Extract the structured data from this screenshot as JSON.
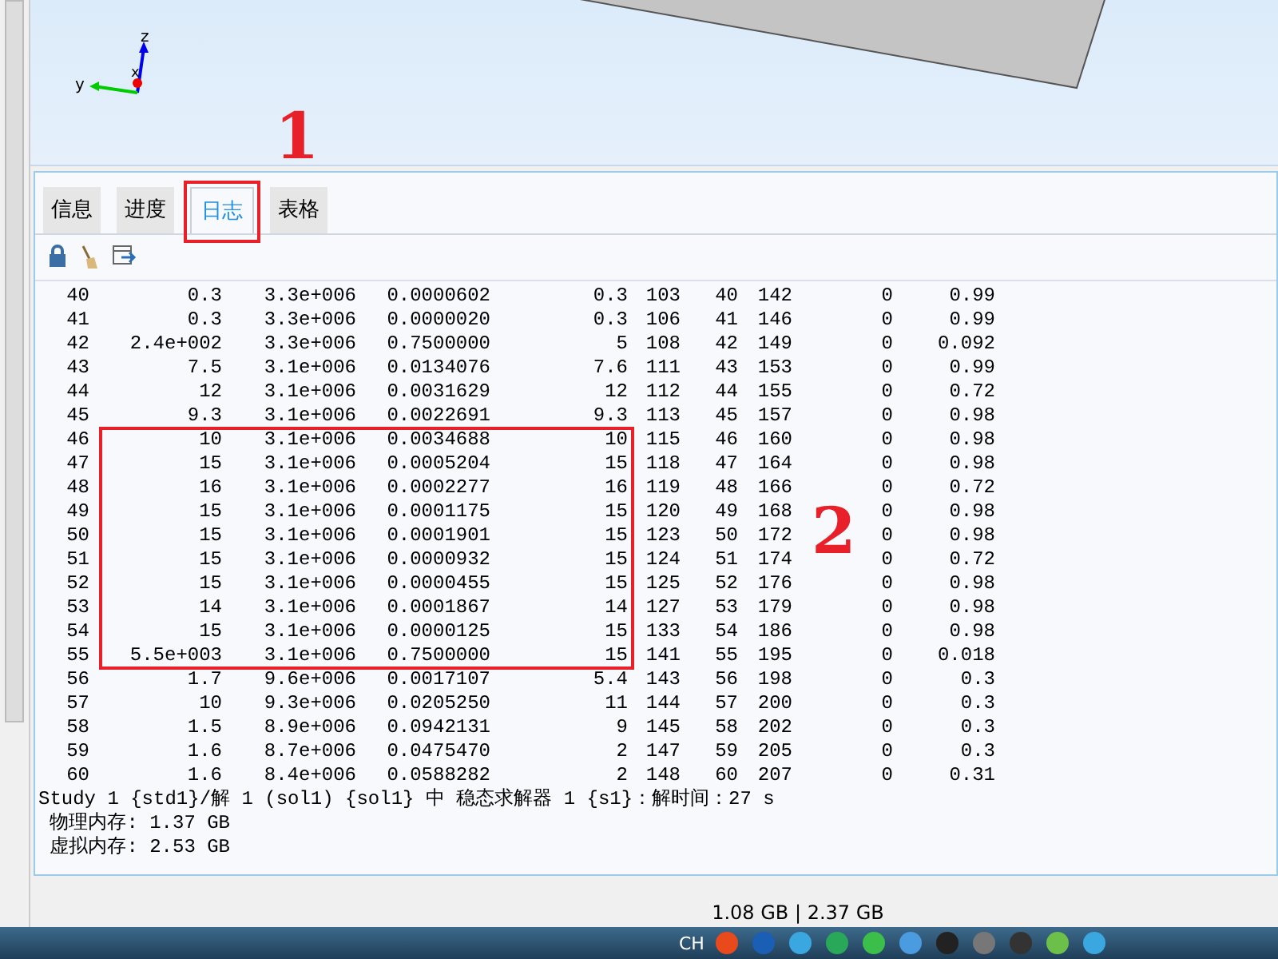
{
  "viewport": {
    "axes": [
      "z",
      "x",
      "y"
    ]
  },
  "tabs": [
    {
      "label": "信息",
      "selected": false
    },
    {
      "label": "进度",
      "selected": false
    },
    {
      "label": "日志",
      "selected": true
    },
    {
      "label": "表格",
      "selected": false
    }
  ],
  "log": {
    "rows": [
      [
        "40",
        "0.3",
        "3.3e+006",
        "0.0000602",
        "0.3",
        "103",
        "40",
        "142",
        "0",
        "0.99"
      ],
      [
        "41",
        "0.3",
        "3.3e+006",
        "0.0000020",
        "0.3",
        "106",
        "41",
        "146",
        "0",
        "0.99"
      ],
      [
        "42",
        "2.4e+002",
        "3.3e+006",
        "0.7500000",
        "5",
        "108",
        "42",
        "149",
        "0",
        "0.092"
      ],
      [
        "43",
        "7.5",
        "3.1e+006",
        "0.0134076",
        "7.6",
        "111",
        "43",
        "153",
        "0",
        "0.99"
      ],
      [
        "44",
        "12",
        "3.1e+006",
        "0.0031629",
        "12",
        "112",
        "44",
        "155",
        "0",
        "0.72"
      ],
      [
        "45",
        "9.3",
        "3.1e+006",
        "0.0022691",
        "9.3",
        "113",
        "45",
        "157",
        "0",
        "0.98"
      ],
      [
        "46",
        "10",
        "3.1e+006",
        "0.0034688",
        "10",
        "115",
        "46",
        "160",
        "0",
        "0.98"
      ],
      [
        "47",
        "15",
        "3.1e+006",
        "0.0005204",
        "15",
        "118",
        "47",
        "164",
        "0",
        "0.98"
      ],
      [
        "48",
        "16",
        "3.1e+006",
        "0.0002277",
        "16",
        "119",
        "48",
        "166",
        "0",
        "0.72"
      ],
      [
        "49",
        "15",
        "3.1e+006",
        "0.0001175",
        "15",
        "120",
        "49",
        "168",
        "0",
        "0.98"
      ],
      [
        "50",
        "15",
        "3.1e+006",
        "0.0001901",
        "15",
        "123",
        "50",
        "172",
        "0",
        "0.98"
      ],
      [
        "51",
        "15",
        "3.1e+006",
        "0.0000932",
        "15",
        "124",
        "51",
        "174",
        "0",
        "0.72"
      ],
      [
        "52",
        "15",
        "3.1e+006",
        "0.0000455",
        "15",
        "125",
        "52",
        "176",
        "0",
        "0.98"
      ],
      [
        "53",
        "14",
        "3.1e+006",
        "0.0001867",
        "14",
        "127",
        "53",
        "179",
        "0",
        "0.98"
      ],
      [
        "54",
        "15",
        "3.1e+006",
        "0.0000125",
        "15",
        "133",
        "54",
        "186",
        "0",
        "0.98"
      ],
      [
        "55",
        "5.5e+003",
        "3.1e+006",
        "0.7500000",
        "15",
        "141",
        "55",
        "195",
        "0",
        "0.018"
      ],
      [
        "56",
        "1.7",
        "9.6e+006",
        "0.0017107",
        "5.4",
        "143",
        "56",
        "198",
        "0",
        "0.3"
      ],
      [
        "57",
        "10",
        "9.3e+006",
        "0.0205250",
        "11",
        "144",
        "57",
        "200",
        "0",
        "0.3"
      ],
      [
        "58",
        "1.5",
        "8.9e+006",
        "0.0942131",
        "9",
        "145",
        "58",
        "202",
        "0",
        "0.3"
      ],
      [
        "59",
        "1.6",
        "8.7e+006",
        "0.0475470",
        "2",
        "147",
        "59",
        "205",
        "0",
        "0.3"
      ],
      [
        "60",
        "1.6",
        "8.4e+006",
        "0.0588282",
        "2",
        "148",
        "60",
        "207",
        "0",
        "0.31"
      ]
    ],
    "lines": [
      "Study 1 {std1}/解 1 (sol1) {sol1} 中 稳态求解器 1 {s1}：解时间：27 s",
      " 物理内存: 1.37 GB",
      " 虚拟内存: 2.53 GB"
    ]
  },
  "annotations": [
    "1",
    "2"
  ],
  "status_bar": {
    "memory": "1.08 GB | 2.37 GB"
  },
  "taskbar": {
    "language": "CH"
  }
}
